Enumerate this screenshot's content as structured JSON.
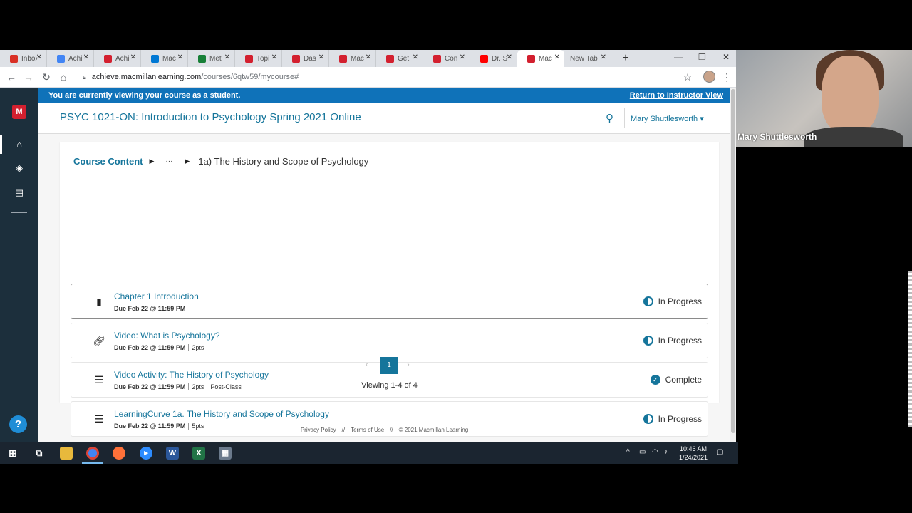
{
  "browser": {
    "tabs": [
      {
        "label": "Inbox",
        "color": "#d93025"
      },
      {
        "label": "Achi",
        "color": "#4285f4"
      },
      {
        "label": "Achi",
        "color": "#d3202f"
      },
      {
        "label": "Mac",
        "color": "#0078d4"
      },
      {
        "label": "Met",
        "color": "#188038"
      },
      {
        "label": "Topi",
        "color": "#d3202f"
      },
      {
        "label": "Das",
        "color": "#d3202f"
      },
      {
        "label": "Mac",
        "color": "#d3202f"
      },
      {
        "label": "Get",
        "color": "#d3202f"
      },
      {
        "label": "Con",
        "color": "#d3202f"
      },
      {
        "label": "Dr. S",
        "color": "#ff0000"
      },
      {
        "label": "Mac",
        "color": "#d3202f"
      },
      {
        "label": "New Tab",
        "color": ""
      }
    ],
    "active_tab_index": 11,
    "new_tab": "+",
    "url_domain": "achieve.macmillanlearning.com",
    "url_path": "/courses/6qtw59/mycourse#"
  },
  "banner": {
    "message": "You are currently viewing your course as a student.",
    "return_link": "Return to Instructor View"
  },
  "course": {
    "title": "PSYC 1021-ON: Introduction to Psychology Spring 2021 Online",
    "user_menu": "Mary Shuttlesworth ▾"
  },
  "breadcrumb": {
    "root": "Course Content",
    "ellipsis": "···",
    "current": "1a) The History and Scope of Psychology"
  },
  "items": [
    {
      "title": "Chapter 1 Introduction",
      "due": "Due Feb 22 @ 11:59 PM",
      "points": "",
      "tag": "",
      "status": "In Progress",
      "icon": "book-icon"
    },
    {
      "title": "Video: What is Psychology?",
      "due": "Due Feb 22 @ 11:59 PM",
      "points": "2pts",
      "tag": "",
      "status": "In Progress",
      "icon": "link-icon"
    },
    {
      "title": "Video Activity: The History of Psychology",
      "due": "Due Feb 22 @ 11:59 PM",
      "points": "2pts",
      "tag": "Post-Class",
      "status": "Complete",
      "icon": "assignment-icon"
    },
    {
      "title": "LearningCurve 1a. The History and Scope of Psychology",
      "due": "Due Feb 22 @ 11:59 PM",
      "points": "5pts",
      "tag": "",
      "status": "In Progress",
      "icon": "assignment-icon"
    }
  ],
  "pagination": {
    "prev": "‹",
    "current": "1",
    "next": "›",
    "viewing": "Viewing 1-4 of 4"
  },
  "footer": {
    "privacy": "Privacy Policy",
    "separator": "//",
    "terms": "Terms of Use",
    "copyright": "© 2021 Macmillan Learning"
  },
  "taskbar": {
    "time": "10:46 AM",
    "date": "1/24/2021"
  },
  "webcam": {
    "name": "Mary Shuttlesworth"
  },
  "colors": {
    "accent": "#15759b",
    "banner": "#0f72b9",
    "nav": "#1c2f3c",
    "brand_red": "#d3202f"
  }
}
